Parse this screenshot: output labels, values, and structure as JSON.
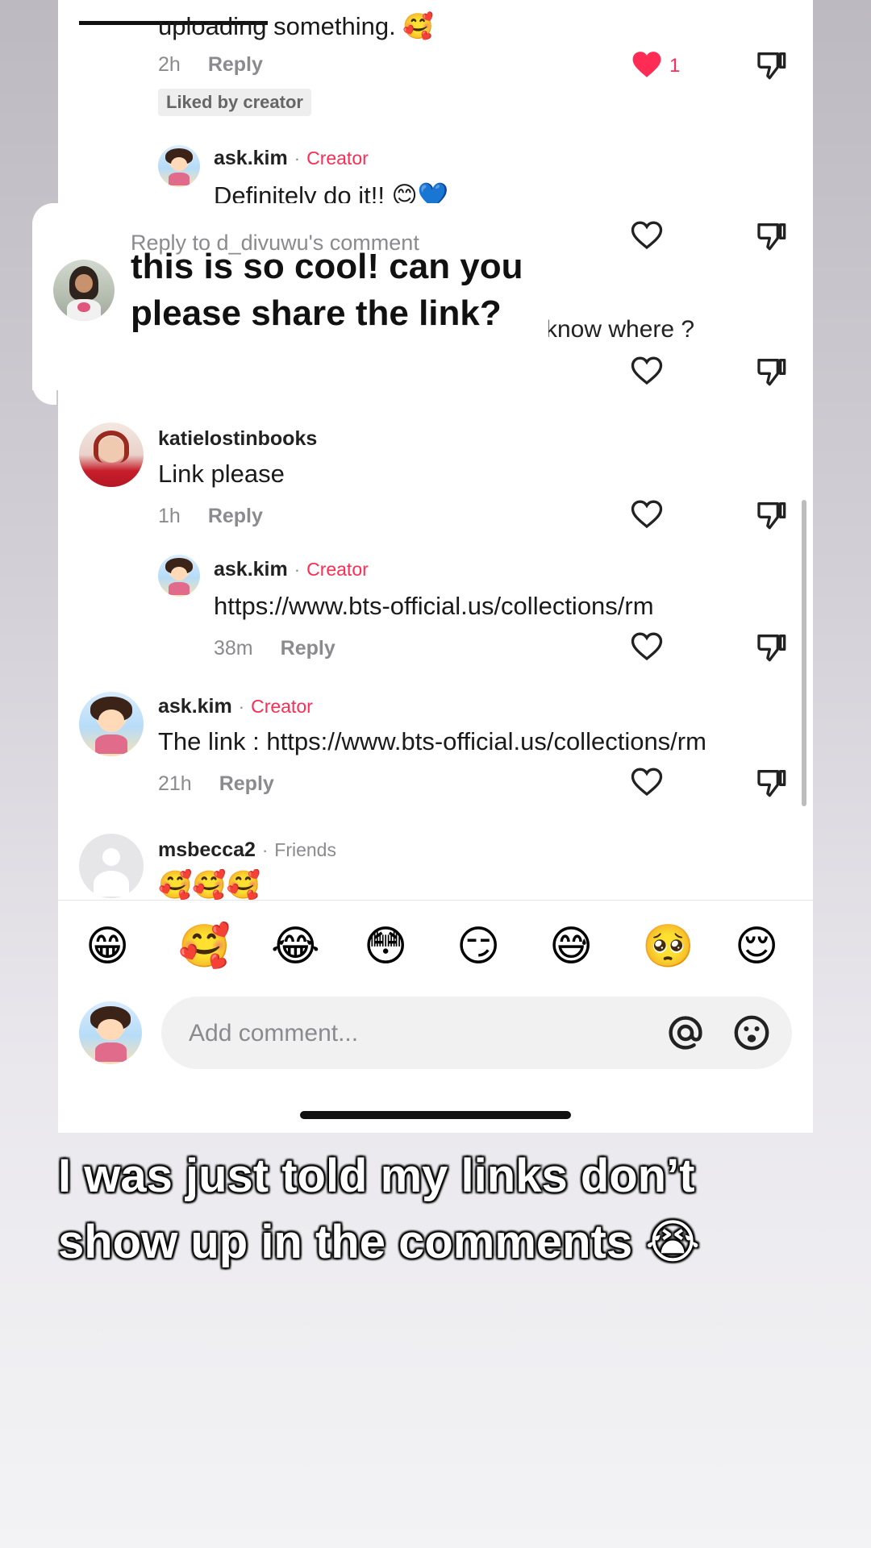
{
  "comments": [
    {
      "body": "uploading something. 🥰",
      "time": "2h",
      "reply_label": "Reply",
      "like_count": "1",
      "liked_badge": "Liked by creator",
      "reply": {
        "username": "ask.kim",
        "role": "Creator",
        "body": "Definitely do it!! 😊💙"
      }
    },
    {
      "partial_body": "know where ?"
    },
    {
      "username": "katielostinbooks",
      "body": "Link please",
      "time": "1h",
      "reply_label": "Reply",
      "reply": {
        "username": "ask.kim",
        "role": "Creator",
        "body": "https://www.bts-official.us/collections/rm",
        "time": "38m",
        "reply_label": "Reply"
      }
    },
    {
      "username": "ask.kim",
      "role": "Creator",
      "body": "The link : https://www.bts-official.us/collections/rm",
      "time": "21h",
      "reply_label": "Reply"
    },
    {
      "username": "msbecca2",
      "role": "Friends",
      "body": "🥰🥰🥰"
    }
  ],
  "popup": {
    "reply_to": "Reply to d_divuwu's comment",
    "text": "this is so cool! can you please share the link?"
  },
  "emoji_bar": [
    "😁",
    "🥰",
    "😂",
    "😳",
    "😏",
    "😅",
    "🥺",
    "😌"
  ],
  "composer": {
    "placeholder": "Add comment...",
    "mention_icon": "at-icon",
    "emoji_icon": "smiley-icon"
  },
  "caption": "I was just told my links don’t show up in the comments 😭",
  "colors": {
    "accent": "#fe2c55",
    "muted": "#8a8a8f"
  }
}
